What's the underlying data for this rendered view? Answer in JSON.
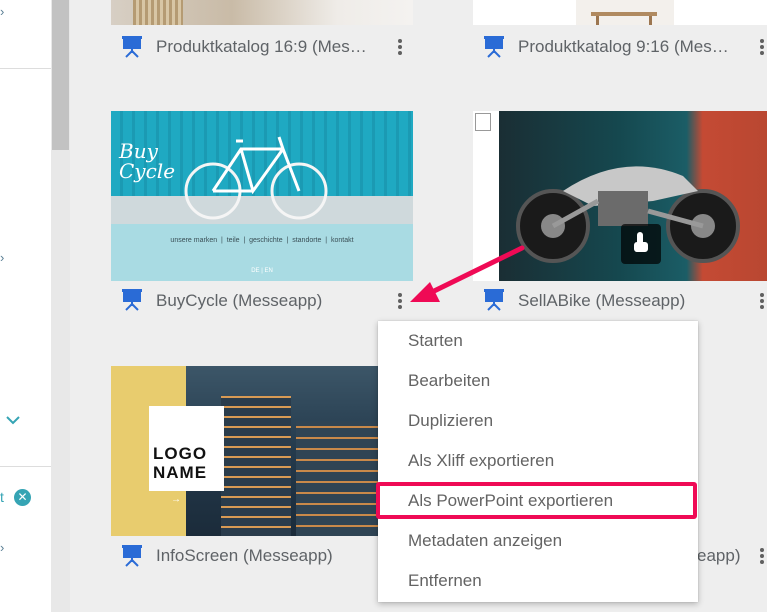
{
  "cards": [
    {
      "title": "Produktkatalog 16:9 (Mes…"
    },
    {
      "title": "Produktkatalog 9:16 (Mes…"
    },
    {
      "title": "BuyCycle (Messeapp)"
    },
    {
      "title": "SellABike (Messeapp)"
    },
    {
      "title": "InfoScreen (Messeapp)"
    },
    {
      "title": "eapp)"
    }
  ],
  "thumbs": {
    "buycycle": {
      "logo": "Buy Cycle",
      "nav": "unsere marken  |  teile  |  geschichte  |  standorte  |  kontakt",
      "lang": "DE | EN"
    },
    "infoscreen": {
      "logo_line1": "LOGO",
      "logo_line2": "NAME",
      "arrow": "→"
    }
  },
  "context_menu": {
    "items": [
      "Starten",
      "Bearbeiten",
      "Duplizieren",
      "Als Xliff exportieren",
      "Als PowerPoint exportieren",
      "Metadaten anzeigen",
      "Entfernen"
    ],
    "highlighted_index": 4
  },
  "colors": {
    "accent_arrow": "#ef0a55",
    "icon_blue": "#2a6bd6",
    "teal": "#35a4b4"
  },
  "icons": [
    "presentation-icon",
    "kebab-menu-icon",
    "chevron-right-icon",
    "chevron-down-icon",
    "clear-filter-icon"
  ]
}
